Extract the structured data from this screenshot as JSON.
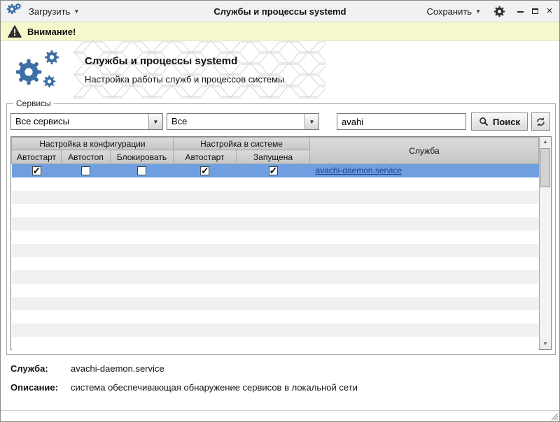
{
  "titlebar": {
    "load_label": "Загрузить",
    "title": "Службы и процессы systemd",
    "save_label": "Сохранить"
  },
  "warning": {
    "text": "Внимание!"
  },
  "header": {
    "title": "Службы и процессы systemd",
    "subtitle": "Настройка работы служб и процессов системы"
  },
  "controls": {
    "legend": "Сервисы",
    "service_filter": "Все сервисы",
    "state_filter": "Все",
    "search_value": "avahi",
    "search_label": "Поиск"
  },
  "table": {
    "group_config": "Настройка в конфигурации",
    "group_system": "Настройка в системе",
    "service_header": "Служба",
    "col_autostart_cfg": "Автостарт",
    "col_autostop": "Автостоп",
    "col_block": "Блокировать",
    "col_autostart_sys": "Автостарт",
    "col_running": "Запущена",
    "rows": [
      {
        "config_autostart": true,
        "config_autostop": false,
        "config_block": false,
        "system_autostart": true,
        "system_running": true,
        "service": "avachi-daemon.service"
      }
    ]
  },
  "details": {
    "service_label": "Служба:",
    "service_value": "avachi-daemon.service",
    "description_label": "Описание:",
    "description_value": "система обеспечивающая обнаружение сервисов в локальной сети"
  },
  "colors": {
    "selection": "#6f9fe0",
    "warning_bg": "#f7f7cc",
    "accent_blue": "#3d6ea5",
    "link": "#17418f"
  }
}
